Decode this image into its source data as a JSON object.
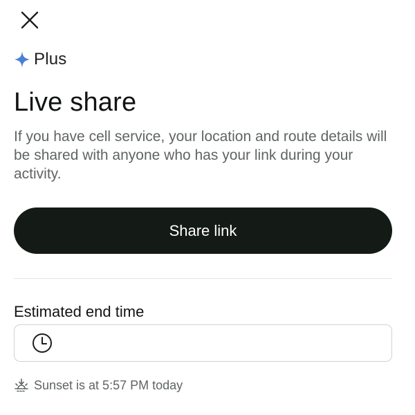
{
  "header": {
    "close_icon": "close-icon"
  },
  "badge": {
    "icon": "sparkle-icon",
    "label": "Plus",
    "accent_color": "#4a7fd6"
  },
  "title": "Live share",
  "description": "If you have cell service, your location and route details will be shared with anyone who has your link during your activity.",
  "share_button": {
    "label": "Share link",
    "background_color": "#141a16"
  },
  "end_time": {
    "label": "Estimated end time",
    "icon": "clock-icon",
    "value": ""
  },
  "sunset": {
    "icon": "sunset-icon",
    "text": "Sunset is at 5:57 PM today"
  }
}
